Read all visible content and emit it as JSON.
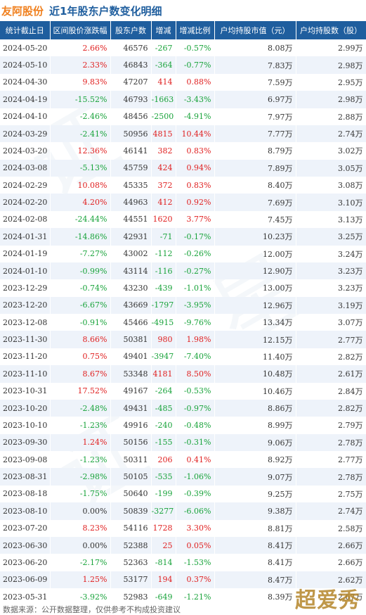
{
  "header": {
    "company": "友阿股份",
    "title": "近1年股东户数变化明细"
  },
  "columns": [
    "统计截止日",
    "区间股价涨跌幅",
    "股东户数",
    "增减",
    "增减比例",
    "户均持股市值（元）",
    "户均持股数（股）"
  ],
  "chart_data": {
    "type": "table",
    "title": "近1年股东户数变化明细",
    "columns": [
      "统计截止日",
      "区间股价涨跌幅",
      "股东户数",
      "增减",
      "增减比例",
      "户均持股市值（元）",
      "户均持股数（股）"
    ],
    "rows": [
      [
        "2024-05-20",
        "2.66%",
        "46576",
        "-267",
        "-0.57%",
        "8.08万",
        "2.99万"
      ],
      [
        "2024-05-10",
        "2.33%",
        "46843",
        "-364",
        "-0.77%",
        "7.83万",
        "2.98万"
      ],
      [
        "2024-04-30",
        "9.83%",
        "47207",
        "414",
        "0.88%",
        "7.59万",
        "2.95万"
      ],
      [
        "2024-04-19",
        "-15.52%",
        "46793",
        "-1663",
        "-3.43%",
        "6.97万",
        "2.98万"
      ],
      [
        "2024-04-10",
        "-2.46%",
        "48456",
        "-2500",
        "-4.91%",
        "7.97万",
        "2.88万"
      ],
      [
        "2024-03-29",
        "-2.41%",
        "50956",
        "4815",
        "10.44%",
        "7.77万",
        "2.74万"
      ],
      [
        "2024-03-20",
        "12.36%",
        "46141",
        "382",
        "0.83%",
        "8.79万",
        "3.02万"
      ],
      [
        "2024-03-08",
        "-5.13%",
        "45759",
        "424",
        "0.94%",
        "7.89万",
        "3.05万"
      ],
      [
        "2024-02-29",
        "10.08%",
        "45335",
        "372",
        "0.83%",
        "8.40万",
        "3.08万"
      ],
      [
        "2024-02-20",
        "4.20%",
        "44963",
        "412",
        "0.92%",
        "7.69万",
        "3.10万"
      ],
      [
        "2024-02-08",
        "-24.44%",
        "44551",
        "1620",
        "3.77%",
        "7.45万",
        "3.13万"
      ],
      [
        "2024-01-31",
        "-14.86%",
        "42931",
        "-71",
        "-0.17%",
        "10.23万",
        "3.25万"
      ],
      [
        "2024-01-19",
        "-7.27%",
        "43002",
        "-112",
        "-0.26%",
        "12.00万",
        "3.24万"
      ],
      [
        "2024-01-10",
        "-0.99%",
        "43114",
        "-116",
        "-0.27%",
        "12.90万",
        "3.23万"
      ],
      [
        "2023-12-29",
        "-0.74%",
        "43230",
        "-439",
        "-1.01%",
        "13.00万",
        "3.23万"
      ],
      [
        "2023-12-20",
        "-6.67%",
        "43669",
        "-1797",
        "-3.95%",
        "12.96万",
        "3.19万"
      ],
      [
        "2023-12-08",
        "-0.91%",
        "45466",
        "-4915",
        "-9.76%",
        "13.34万",
        "3.07万"
      ],
      [
        "2023-11-30",
        "8.66%",
        "50381",
        "980",
        "1.98%",
        "12.15万",
        "2.77万"
      ],
      [
        "2023-11-20",
        "0.75%",
        "49401",
        "-3947",
        "-7.40%",
        "11.40万",
        "2.82万"
      ],
      [
        "2023-11-10",
        "8.67%",
        "53348",
        "4181",
        "8.50%",
        "10.48万",
        "2.61万"
      ],
      [
        "2023-10-31",
        "17.52%",
        "49167",
        "-264",
        "-0.53%",
        "10.46万",
        "2.84万"
      ],
      [
        "2023-10-20",
        "-2.48%",
        "49431",
        "-485",
        "-0.97%",
        "8.86万",
        "2.82万"
      ],
      [
        "2023-10-10",
        "-1.23%",
        "49916",
        "-240",
        "-0.48%",
        "8.99万",
        "2.79万"
      ],
      [
        "2023-09-30",
        "1.24%",
        "50156",
        "-155",
        "-0.31%",
        "9.06万",
        "2.78万"
      ],
      [
        "2023-09-08",
        "-1.23%",
        "50311",
        "206",
        "0.41%",
        "8.92万",
        "2.77万"
      ],
      [
        "2023-08-31",
        "-2.98%",
        "50105",
        "-535",
        "-1.06%",
        "9.07万",
        "2.78万"
      ],
      [
        "2023-08-18",
        "-1.75%",
        "50640",
        "-199",
        "-0.39%",
        "9.25万",
        "2.75万"
      ],
      [
        "2023-08-10",
        "0.00%",
        "50839",
        "-3277",
        "-6.06%",
        "9.38万",
        "2.74万"
      ],
      [
        "2023-07-20",
        "8.23%",
        "54116",
        "1728",
        "3.30%",
        "8.81万",
        "2.58万"
      ],
      [
        "2023-06-30",
        "0.00%",
        "52388",
        "25",
        "0.05%",
        "8.41万",
        "2.66万"
      ],
      [
        "2023-06-20",
        "-2.17%",
        "52363",
        "-814",
        "-1.53%",
        "8.41万",
        "2.66万"
      ],
      [
        "2023-06-09",
        "1.25%",
        "53177",
        "194",
        "0.37%",
        "8.47万",
        "2.62万"
      ],
      [
        "2023-05-31",
        "-3.92%",
        "52983",
        "-649",
        "-1.21%",
        "8.39万",
        "2.67万"
      ]
    ]
  },
  "colors": {
    "header_bg": "#1f5e9e",
    "company": "#f0801e",
    "positive": "#e02020",
    "negative": "#18a33a",
    "stripe": "#eef3fa"
  },
  "footer": "数据来源：公开数据整理，仅供参考不构成投资建议",
  "brand": "超爱秀"
}
